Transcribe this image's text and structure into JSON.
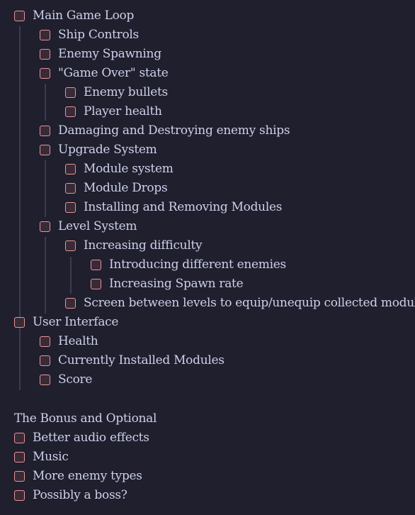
{
  "tasks": [
    {
      "label": "Main Game Loop",
      "level": 0,
      "checked": false
    },
    {
      "label": "Ship Controls",
      "level": 1,
      "checked": false
    },
    {
      "label": "Enemy Spawning",
      "level": 1,
      "checked": false
    },
    {
      "label": "\"Game Over\" state",
      "level": 1,
      "checked": false
    },
    {
      "label": "Enemy bullets",
      "level": 2,
      "checked": false
    },
    {
      "label": "Player health",
      "level": 2,
      "checked": false
    },
    {
      "label": "Damaging and Destroying enemy ships",
      "level": 1,
      "checked": false
    },
    {
      "label": "Upgrade System",
      "level": 1,
      "checked": false
    },
    {
      "label": "Module system",
      "level": 2,
      "checked": false
    },
    {
      "label": "Module Drops",
      "level": 2,
      "checked": false
    },
    {
      "label": "Installing and Removing Modules",
      "level": 2,
      "checked": false
    },
    {
      "label": "Level System",
      "level": 1,
      "checked": false
    },
    {
      "label": "Increasing difficulty",
      "level": 2,
      "checked": false
    },
    {
      "label": "Introducing different enemies",
      "level": 3,
      "checked": false
    },
    {
      "label": "Increasing Spawn rate",
      "level": 3,
      "checked": false
    },
    {
      "label": "Screen between levels to equip/unequip collected modules",
      "level": 2,
      "checked": false
    },
    {
      "label": "User Interface",
      "level": 0,
      "checked": false
    },
    {
      "label": "Health",
      "level": 1,
      "checked": false
    },
    {
      "label": "Currently Installed Modules",
      "level": 1,
      "checked": false
    },
    {
      "label": "Score",
      "level": 1,
      "checked": false
    }
  ],
  "bonus": {
    "heading": "The Bonus and Optional",
    "tasks": [
      {
        "label": "Better audio effects",
        "checked": false
      },
      {
        "label": "Music",
        "checked": false
      },
      {
        "label": "More enemy types",
        "checked": false
      },
      {
        "label": "Possibly a boss?",
        "checked": false
      }
    ]
  },
  "colors": {
    "background": "#1f1f2d",
    "text": "#cdd0ea",
    "checkbox_border": "#e6959d",
    "checkbox_fill": "#392a36",
    "guide_line": "#3b3c50"
  }
}
